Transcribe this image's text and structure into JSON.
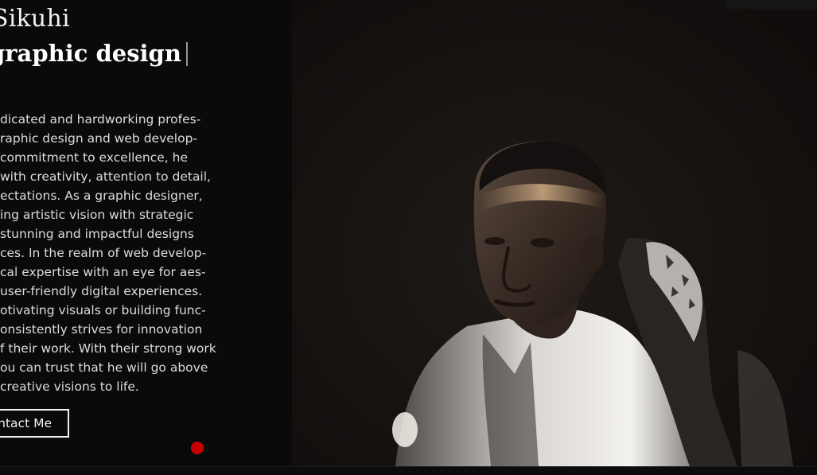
{
  "hero": {
    "name": "Sikuhi",
    "role": "graphic design"
  },
  "bio": {
    "lines": [
      "dicated and hardworking profes-",
      "raphic design and web develop-",
      " commitment to excellence, he",
      "with creativity, attention to detail,",
      "ectations. As a graphic designer,",
      "ing artistic vision with strategic",
      "stunning and impactful designs",
      "ces. In the realm of web develop-",
      "cal expertise with an eye for aes-",
      "user-friendly digital experiences.",
      "otivating visuals or building func-",
      "onsistently strives for innovation",
      "f their work. With their strong work",
      "ou can trust that he will go above",
      "creative visions to life."
    ]
  },
  "contact_button": {
    "label": "ntact Me"
  },
  "colors": {
    "background": "#0a0a0a",
    "text": "#dcdcdc",
    "accent_dot": "#c80000"
  }
}
